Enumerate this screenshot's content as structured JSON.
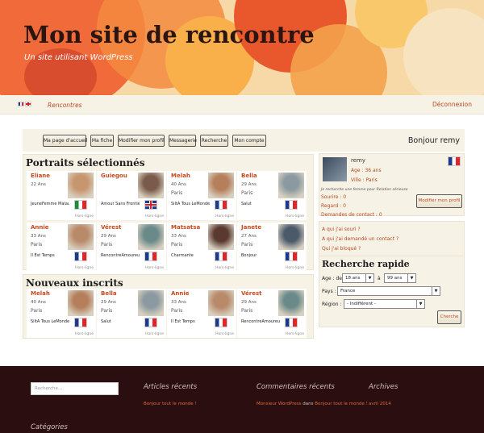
{
  "header": {
    "title": "Mon site de rencontre",
    "tagline": "Un site utilisant WordPress"
  },
  "nav": {
    "link": "Rencontres",
    "login": "Déconnexion"
  },
  "toolbar": {
    "buttons": [
      "Ma page d'accueil",
      "Ma fiche",
      "Modifier mon profil",
      "Messagerie",
      "Recherche",
      "Mon compte"
    ],
    "greeting": "Bonjour remy"
  },
  "portraits": {
    "title": "Portraits sélectionnés",
    "cards": [
      {
        "name": "Eliane",
        "age": "22 Ans",
        "city": "",
        "msg": "JeuneFemme Malaucha Aix",
        "flag": "it",
        "status": "Hors-ligne",
        "photo": "#c7956e"
      },
      {
        "name": "Guiegou",
        "age": "",
        "city": "",
        "msg": "Amour Sans Frontière",
        "flag": "uk",
        "status": "Hors-ligne",
        "photo": "#7a5a4a"
      },
      {
        "name": "Melah",
        "age": "40 Ans",
        "city": "Paris",
        "msg": "SiltA Tous LeMonde",
        "flag": "fr",
        "status": "Hors-ligne",
        "photo": "#b57f5c"
      },
      {
        "name": "Bella",
        "age": "29 Ans",
        "city": "Paris",
        "msg": "Salut",
        "flag": "fr",
        "status": "Hors-ligne",
        "photo": "#8a9aa0"
      },
      {
        "name": "Annie",
        "age": "33 Ans",
        "city": "Paris",
        "msg": "Il Est Temps",
        "flag": "fr",
        "status": "Hors-ligne",
        "photo": "#b88a6a"
      },
      {
        "name": "Vérest",
        "age": "29 Ans",
        "city": "Paris",
        "msg": "RencontreAmoureuse",
        "flag": "fr",
        "status": "Hors-ligne",
        "photo": "#6a8a8a"
      },
      {
        "name": "Matsatsa",
        "age": "33 Ans",
        "city": "Paris",
        "msg": "Charmante",
        "flag": "fr",
        "status": "Hors-ligne",
        "photo": "#5a3a30"
      },
      {
        "name": "Janete",
        "age": "27 Ans",
        "city": "Paris",
        "msg": "Bonjour",
        "flag": "fr",
        "status": "Hors-ligne",
        "photo": "#4a5a6a"
      }
    ]
  },
  "recent": {
    "title": "Nouveaux inscrits",
    "cards": [
      {
        "name": "Melah",
        "age": "40 Ans",
        "city": "Paris",
        "msg": "SiltA Tous LeMonde",
        "flag": "fr",
        "status": "Hors-ligne",
        "photo": "#b57f5c"
      },
      {
        "name": "Bella",
        "age": "29 Ans",
        "city": "Paris",
        "msg": "Salut",
        "flag": "fr",
        "status": "Hors-ligne",
        "photo": "#8a9aa0"
      },
      {
        "name": "Annie",
        "age": "33 Ans",
        "city": "Paris",
        "msg": "Il Est Temps",
        "flag": "fr",
        "status": "Hors-ligne",
        "photo": "#b88a6a"
      },
      {
        "name": "Vérest",
        "age": "29 Ans",
        "city": "Paris",
        "msg": "RencontreAmoureuse",
        "flag": "fr",
        "status": "Hors-ligne",
        "photo": "#6a8a8a"
      }
    ]
  },
  "profile": {
    "name": "remy",
    "age": "Age : 36 ans",
    "city": "Ville : Paris",
    "desc": "Je recherche une femme pour Relation sérieuse",
    "visits": "Sourire : 0",
    "regards": "Regard : 0",
    "contacts": "Demandes de contact : 0",
    "edit": "Modifier mon profil"
  },
  "links": [
    "A qui j'ai souri ?",
    "A qui j'ai demandé un contact ?",
    "Qui j'ai bloqué ?"
  ],
  "quick_search": {
    "title": "Recherche rapide",
    "age_label": "Age : de",
    "age_from": "18 ans",
    "to_label": "à",
    "age_to": "99 ans",
    "country_label": "Pays :",
    "country": "France",
    "region_label": "Région :",
    "region": "- Indifférent -",
    "submit": "Cherche"
  },
  "footer": {
    "search_placeholder": "Recherche...",
    "articles_title": "Articles récents",
    "article_1": "Bonjour tout le monde !",
    "comments_title": "Commentaires récents",
    "comment_author": "Monsieur WordPress",
    "comment_in": "dans",
    "comment_post": "Bonjour tout le monde !",
    "archives_title": "Archives",
    "archive_1": "avril 2014",
    "categories_title": "Catégories"
  }
}
